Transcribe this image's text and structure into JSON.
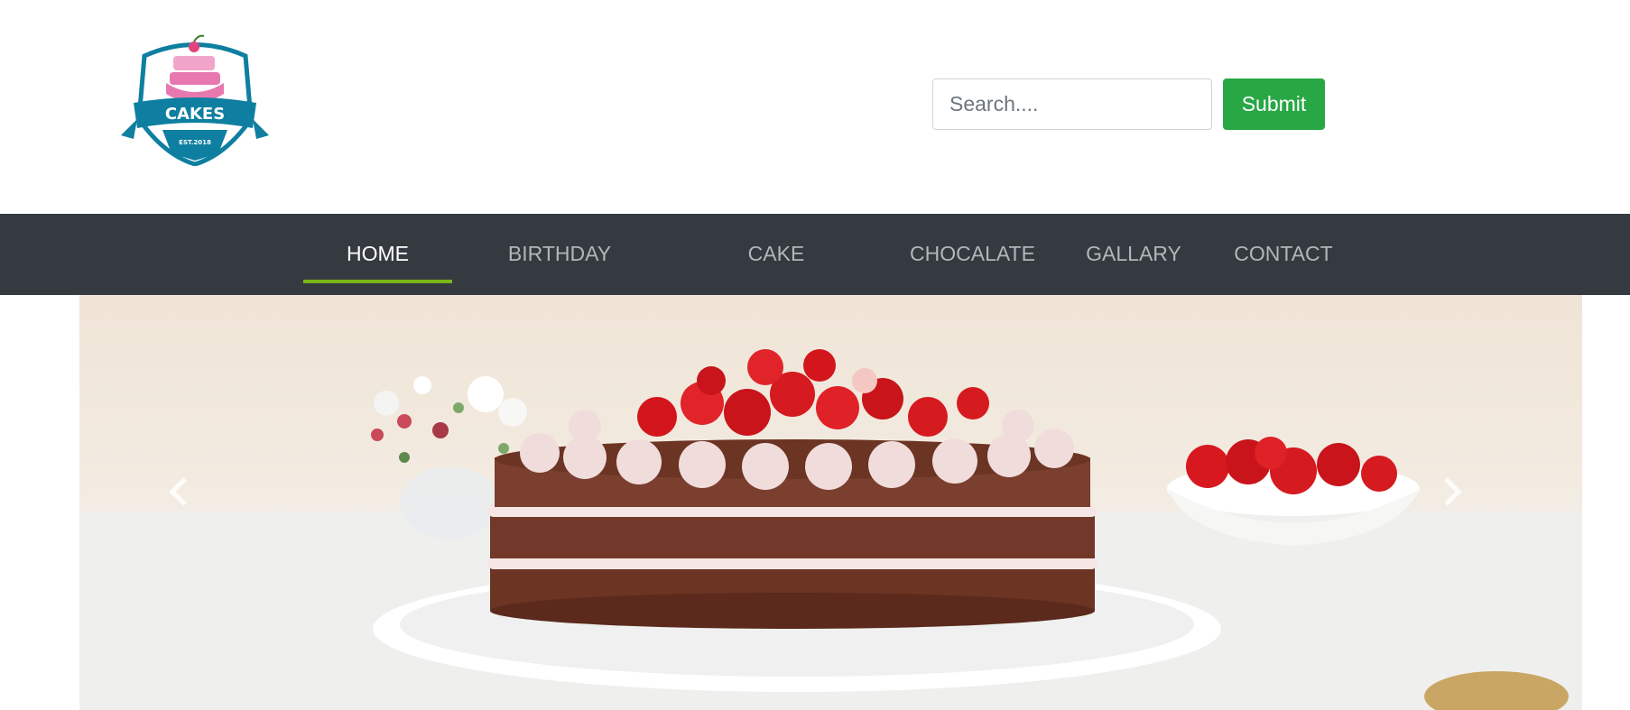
{
  "brand": {
    "logo_text": "CAKES",
    "logo_est": "EST.2018",
    "logo_icon": "cake-badge-icon",
    "primary_color": "#0e7fa0",
    "accent_color": "#e879b0"
  },
  "search": {
    "placeholder": "Search....",
    "value": "",
    "submit_label": "Submit",
    "submit_color": "#28a745"
  },
  "nav": {
    "background": "#343a40",
    "active_underline_color": "#7cb518",
    "items": [
      {
        "label": "HOME",
        "active": true
      },
      {
        "label": "BIRTHDAY",
        "active": false
      },
      {
        "label": "CAKE",
        "active": false
      },
      {
        "label": "CHOCALATE",
        "active": false
      },
      {
        "label": "GALLARY",
        "active": false
      },
      {
        "label": "CONTACT",
        "active": false
      }
    ]
  },
  "carousel": {
    "prev_icon": "chevron-left-icon",
    "next_icon": "chevron-right-icon",
    "slide_subject": "strawberry-cake-image"
  }
}
